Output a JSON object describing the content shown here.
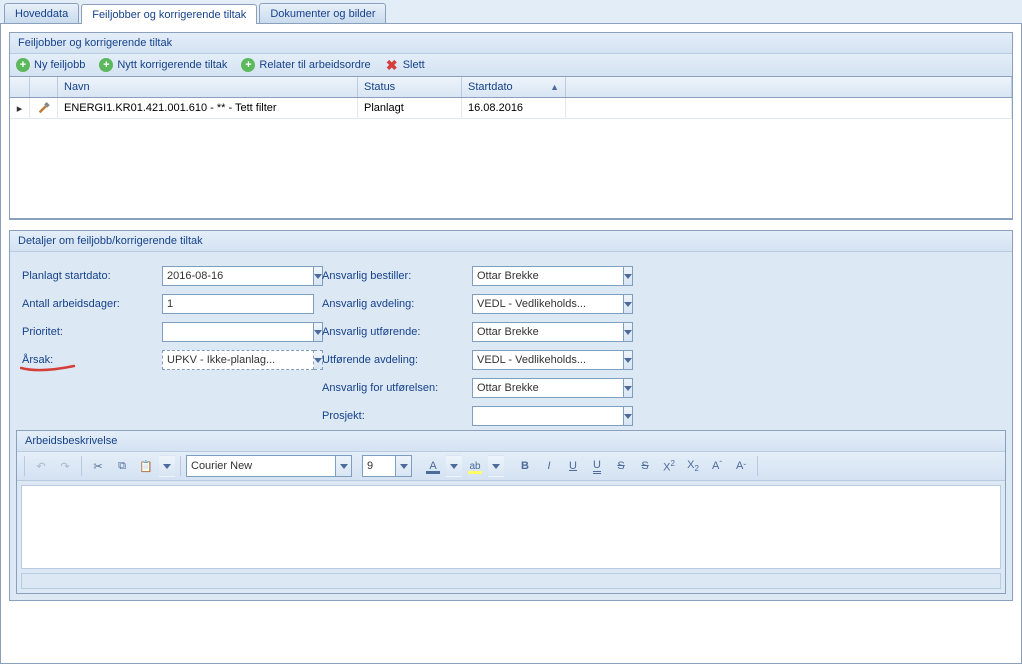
{
  "tabs": [
    {
      "label": "Hoveddata"
    },
    {
      "label": "Feiljobber og korrigerende tiltak"
    },
    {
      "label": "Dokumenter og bilder"
    }
  ],
  "panel1": {
    "title": "Feiljobber og korrigerende tiltak",
    "toolbar": {
      "new_job": "Ny feiljobb",
      "new_corr": "Nytt korrigerende tiltak",
      "relate": "Relater til arbeidsordre",
      "delete": "Slett"
    },
    "grid": {
      "headers": {
        "name": "Navn",
        "status": "Status",
        "startdate": "Startdato"
      },
      "rows": [
        {
          "name": "ENERGI1.KR01.421.001.610 - ** - Tett filter",
          "status": "Planlagt",
          "date": "16.08.2016"
        }
      ]
    }
  },
  "panel2": {
    "title": "Detaljer om feiljobb/korrigerende tiltak",
    "left": {
      "planned_label": "Planlagt startdato:",
      "planned_value": "2016-08-16",
      "workdays_label": "Antall arbeidsdager:",
      "workdays_value": "1",
      "priority_label": "Prioritet:",
      "priority_value": "",
      "cause_label": "Årsak:",
      "cause_value": "UPKV - Ikke-planlag..."
    },
    "right": {
      "resp_order_label": "Ansvarlig bestiller:",
      "resp_order_value": "Ottar Brekke",
      "resp_dept_label": "Ansvarlig avdeling:",
      "resp_dept_value": "VEDL - Vedlikeholds...",
      "resp_exec_label": "Ansvarlig utførende:",
      "resp_exec_value": "Ottar Brekke",
      "exec_dept_label": "Utførende avdeling:",
      "exec_dept_value": "VEDL - Vedlikeholds...",
      "resp_execution_label": "Ansvarlig for utførelsen:",
      "resp_execution_value": "Ottar Brekke",
      "project_label": "Prosjekt:",
      "project_value": ""
    }
  },
  "editor": {
    "title": "Arbeidsbeskrivelse",
    "font": "Courier New",
    "size": "9",
    "content": ""
  }
}
